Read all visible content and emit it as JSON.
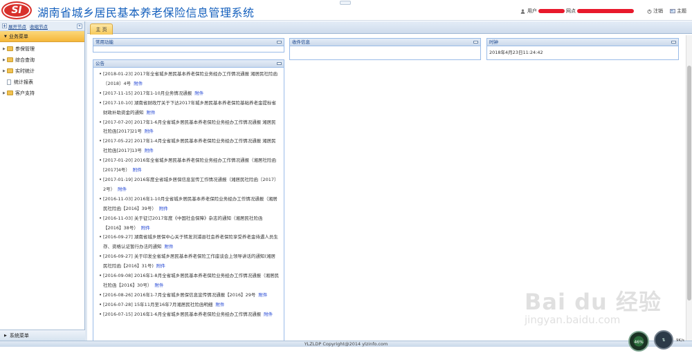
{
  "header": {
    "logo_text": "SI",
    "title": "湖南省城乡居民基本养老保险信息管理系统",
    "user_label": "用户",
    "site_label": "网点",
    "logout_label": "注销",
    "theme_label": "主题"
  },
  "sidebar": {
    "expand_label": "展开节点",
    "collapse_label": "收缩节点",
    "collapse_button": "«",
    "biz_menu": "业务菜单",
    "items": [
      {
        "label": "参保管理",
        "type": "folder"
      },
      {
        "label": "综合查询",
        "type": "folder"
      },
      {
        "label": "实时统计",
        "type": "folder"
      },
      {
        "label": "统计报表",
        "type": "doc"
      },
      {
        "label": "客户支持",
        "type": "folder"
      }
    ],
    "system_menu": "系统菜单"
  },
  "tabs": {
    "home": "主 页"
  },
  "panels": {
    "common": "常用功能",
    "notice": "公告",
    "income": "收件信息",
    "clock": "时钟",
    "clock_value": "2018年4月23日11:24:42"
  },
  "notices": [
    {
      "text": "[2018-01-23]  2017年全省城乡居民基本养老保险业务经办工作情况通报 湘居民社险函〔2018〕4号",
      "att": "附件"
    },
    {
      "text": "[2017-11-15]  2017年1-10月业务情况通报",
      "att": "附件"
    },
    {
      "text": "[2017-10-10]  湖南省财政厅关于下达2017年城乡居民基本养老保险基础养老金提标省财政补助资金的通知",
      "att": "附件"
    },
    {
      "text": "[2017-07-20]  2017年1-6月全省城乡居民基本养老保险业务经办工作情况通报 湘居民社险函[2017]21号",
      "att": "附件"
    },
    {
      "text": "[2017-05-22]  2017年1-4月全省城乡居民基本养老保险业务经办工作情况通报 湘居民社险函[2017]13号",
      "att": "附件"
    },
    {
      "text": "[2017-01-20]  2016年全省城乡居民基本养老保险业务经办工作情况通报（湘居社险函[2017]4号）",
      "att": "附件"
    },
    {
      "text": "[2017-01-19]  2016年度全省城乡居保信息宣传工作情况通报（湘居民社险函〔2017〕2号）",
      "att": "附件"
    },
    {
      "text": "[2016-11-03]  2016年1-10月全省城乡居民基本养老保险业务经办工作情况通报（湘居民社险函【2016】39号）",
      "att": "附件"
    },
    {
      "text": "[2016-11-03]  关于征订2017年度《中国社会保障》杂志的通知（湘居民社险函【2016】38号）",
      "att": "附件"
    },
    {
      "text": "[2016-09-27]  湖南省城乡居保中心关于转发浏浦县社会养老保险享受养老金待遇人员生存、资格认证暂行办法的通知",
      "att": "附件"
    },
    {
      "text": "[2016-09-27]  关于印发全省城乡居民基本养老保险工作座谈会上领导讲话的通知(湘居民社险函【2016】31号)",
      "att": "附件"
    },
    {
      "text": "[2016-09-08]  2016年1-8月全省城乡居民基本养老保险业务经办工作情况通报（湘居民社险函【2016】30号）",
      "att": "附件"
    },
    {
      "text": "[2016-08-26]  2016年1-7月全省城乡居保信息宣传情况通报【2016】29号",
      "att": "附件"
    },
    {
      "text": "[2016-07-28]  15年11月至16年7月湘居民社险函明细",
      "att": "附件"
    },
    {
      "text": "[2016-07-15]  2016年1-6月全省城乡居民基本养老保险业务经办工作情况通报",
      "att": "附件"
    }
  ],
  "footer": "YLZLDP Copyright@2014 ylzinfo.com",
  "widget": {
    "gauge": "46%",
    "speed": "9K/s"
  },
  "watermark": {
    "main": "Bai du 经验",
    "sub": "jingyan.baidu.com"
  },
  "colors": {
    "title_blue": "#1560bd",
    "accent_orange": "#f5b73a",
    "panel_border": "#99bbe8",
    "link_blue": "#1a3fd3"
  }
}
